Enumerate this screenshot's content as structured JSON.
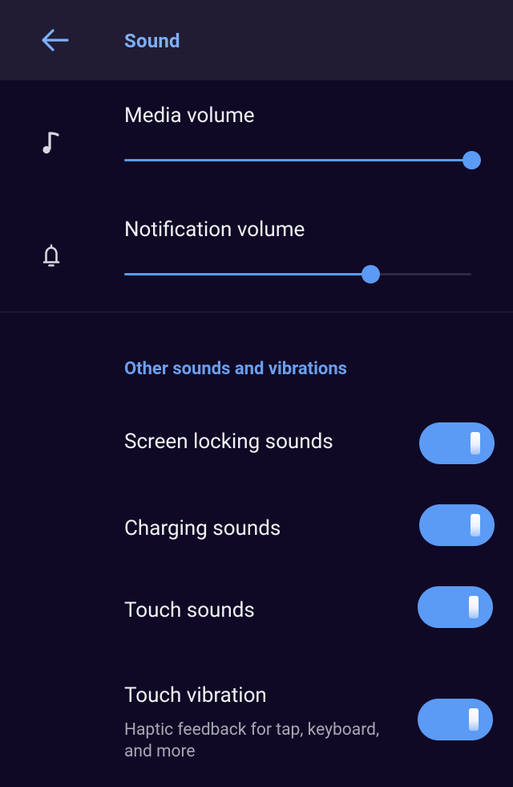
{
  "appbar": {
    "title": "Sound",
    "back_icon": "arrow-left-icon"
  },
  "volume": {
    "media": {
      "label": "Media volume",
      "icon": "music-note-icon",
      "level": 1.0
    },
    "notification": {
      "label": "Notification volume",
      "icon": "bell-icon",
      "level": 0.71
    }
  },
  "other": {
    "header": "Other sounds and vibrations",
    "items": [
      {
        "label": "Screen locking sounds",
        "subtitle": "",
        "on": true
      },
      {
        "label": "Charging sounds",
        "subtitle": "",
        "on": true
      },
      {
        "label": "Touch sounds",
        "subtitle": "",
        "on": true
      },
      {
        "label": "Touch vibration",
        "subtitle": "Haptic feedback for tap, keyboard, and more",
        "on": true
      }
    ]
  },
  "colors": {
    "background": "#100925",
    "appbar": "#211C33",
    "accent": "#5B9BF5",
    "header_text": "#7EB0FA",
    "primary_text": "#F2F2F5",
    "secondary_text": "#A9A6B5"
  }
}
